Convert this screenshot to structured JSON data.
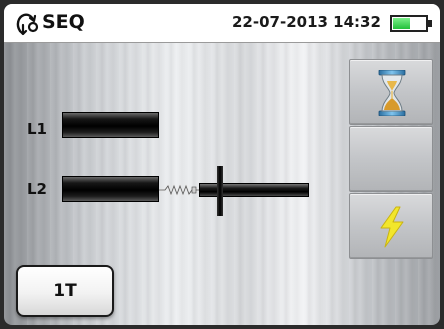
{
  "header": {
    "title": "SEQ",
    "datetime": "22-07-2013 14:32",
    "battery_level": 0.55,
    "battery_color": "#22c03a"
  },
  "phases": [
    {
      "label": "L1"
    },
    {
      "label": "L2"
    }
  ],
  "side_buttons": [
    {
      "icon": "hourglass-icon"
    },
    {
      "icon": "blank"
    },
    {
      "icon": "lightning-icon",
      "color": "#f2e62b"
    }
  ],
  "mode_button": {
    "label": "1T"
  }
}
